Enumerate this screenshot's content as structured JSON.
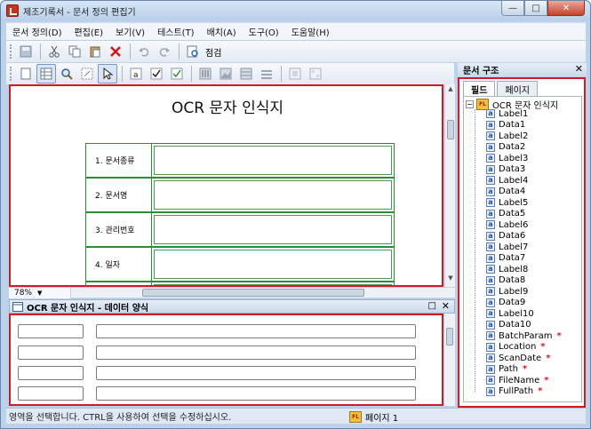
{
  "window": {
    "title": "제조기록서 - 문서 정의 편집기",
    "close": "✕",
    "minimize": "—",
    "maximize": "□"
  },
  "menu": [
    "문서 정의(D)",
    "편집(E)",
    "보기(V)",
    "테스트(T)",
    "배치(A)",
    "도구(O)",
    "도움말(H)"
  ],
  "toolbar": {
    "check_label": "점검"
  },
  "document": {
    "title": "OCR 문자 인식지",
    "rows": [
      "1. 문서종류",
      "2. 문서명",
      "3. 관리번호",
      "4. 일자"
    ],
    "zoom": "78%"
  },
  "data_panel": {
    "title": "OCR 문자 인식지 - 데이터 양식"
  },
  "side_panel": {
    "title": "문서 구조",
    "tabs": [
      "필드",
      "페이지"
    ],
    "root": "OCR 문자 인식지",
    "items": [
      {
        "label": "Label1",
        "required": false
      },
      {
        "label": "Data1",
        "required": false
      },
      {
        "label": "Label2",
        "required": false
      },
      {
        "label": "Data2",
        "required": false
      },
      {
        "label": "Label3",
        "required": false
      },
      {
        "label": "Data3",
        "required": false
      },
      {
        "label": "Label4",
        "required": false
      },
      {
        "label": "Data4",
        "required": false
      },
      {
        "label": "Label5",
        "required": false
      },
      {
        "label": "Data5",
        "required": false
      },
      {
        "label": "Label6",
        "required": false
      },
      {
        "label": "Data6",
        "required": false
      },
      {
        "label": "Label7",
        "required": false
      },
      {
        "label": "Data7",
        "required": false
      },
      {
        "label": "Label8",
        "required": false
      },
      {
        "label": "Data8",
        "required": false
      },
      {
        "label": "Label9",
        "required": false
      },
      {
        "label": "Data9",
        "required": false
      },
      {
        "label": "Label10",
        "required": false
      },
      {
        "label": "Data10",
        "required": false
      },
      {
        "label": "BatchParam",
        "required": true
      },
      {
        "label": "Location",
        "required": true
      },
      {
        "label": "ScanDate",
        "required": true
      },
      {
        "label": "Path",
        "required": true
      },
      {
        "label": "FileName",
        "required": true
      },
      {
        "label": "FullPath",
        "required": true
      }
    ],
    "required_mark": "*"
  },
  "status": {
    "message": "영역을 선택합니다. CTRL을 사용하여 선택을 수정하십시오.",
    "page": "페이지 1",
    "page_icon": "FL"
  },
  "colors": {
    "highlight": "#d11a22",
    "field_border": "#2e8b3a"
  }
}
